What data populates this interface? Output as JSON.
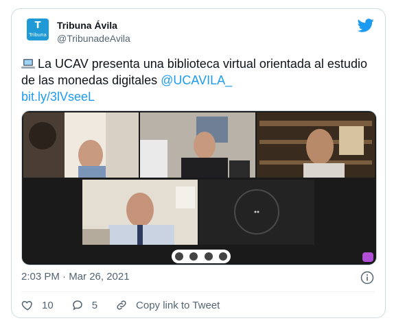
{
  "author": {
    "name": "Tribuna Ávila",
    "handle": "@TribunadeAvila",
    "avatar_text": "T",
    "avatar_word": "Tribuna"
  },
  "tweet": {
    "emoji": "laptop-icon",
    "text_main": "La UCAV presenta una biblioteca virtual orientada al estudio de las monedas digitales",
    "mention": "@UCAVILA_",
    "url": "bit.ly/3lVseeL"
  },
  "timestamp": "2:03 PM · Mar 26, 2021",
  "actions": {
    "likes": "10",
    "replies": "5",
    "copy_link": "Copy link to Tweet"
  },
  "colors": {
    "accent": "#1d9bf0",
    "muted": "#536471",
    "text": "#0f1419"
  }
}
